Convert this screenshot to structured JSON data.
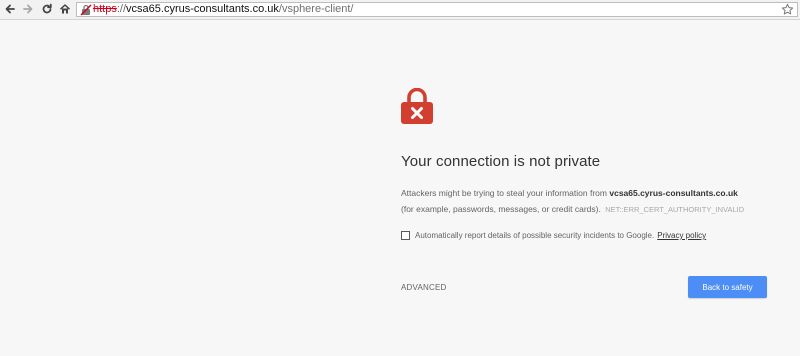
{
  "browser": {
    "url": {
      "scheme": "https",
      "separator": "://",
      "host": "vcsa65.cyrus-consultants.co.uk",
      "path": "/vsphere-client/"
    },
    "security_state": "not-secure"
  },
  "interstitial": {
    "heading": "Your connection is not private",
    "explanation_prefix": "Attackers might be trying to steal your information from",
    "host": "vcsa65.cyrus-consultants.co.uk",
    "explanation_suffix": "(for example, passwords, messages, or credit cards).",
    "error_code": "NET::ERR_CERT_AUTHORITY_INVALID",
    "checkbox_label": "Automatically report details of possible security incidents to Google.",
    "privacy_link": "Privacy policy",
    "advanced_label": "ADVANCED",
    "primary_button": "Back to safety",
    "checkbox_checked": false
  },
  "colors": {
    "lock_red": "#d23f31",
    "primary_blue": "#4c8df6",
    "background": "#f7f7f7"
  },
  "icons": {
    "back": "arrow-left-icon",
    "forward": "arrow-right-icon",
    "reload": "reload-icon",
    "home": "home-icon",
    "broken_lock": "broken-lock-icon",
    "star": "star-icon",
    "big_lock": "lock-error-icon"
  }
}
